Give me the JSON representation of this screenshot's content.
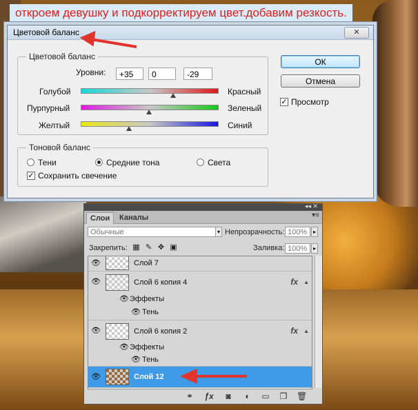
{
  "banner": {
    "text": "откроем девушку и подкорректируем цвет.добавим резкость."
  },
  "dialog": {
    "title": "Цветовой баланс",
    "close_symbol": "✕",
    "color_balance_group": {
      "legend": "Цветовой баланс",
      "levels_label": "Уровни:",
      "levels": [
        "+35",
        "0",
        "-29"
      ],
      "sliders": [
        {
          "left": "Голубой",
          "right": "Красный",
          "value": 35
        },
        {
          "left": "Пурпурный",
          "right": "Зеленый",
          "value": 0
        },
        {
          "left": "Желтый",
          "right": "Синий",
          "value": -29
        }
      ]
    },
    "tone_group": {
      "legend": "Тоновой баланс",
      "options": [
        "Тени",
        "Средние тона",
        "Света"
      ],
      "selected": "Средние тона",
      "preserve_label": "Сохранить свечение",
      "preserve_checked": true
    },
    "ok_label": "ОК",
    "cancel_label": "Отмена",
    "preview_label": "Просмотр",
    "preview_checked": true
  },
  "layers_panel": {
    "tabs": [
      "Слои",
      "Каналы"
    ],
    "active_tab": "Слои",
    "blend_mode": "Обычные",
    "opacity_label": "Непрозрачность:",
    "opacity_value": "100%",
    "lock_label": "Закрепить:",
    "fill_label": "Заливка:",
    "fill_value": "100%",
    "layers": [
      {
        "name": "Слой 7",
        "has_fx": false,
        "selected": false
      },
      {
        "name": "Слой 6 копия 4",
        "has_fx": true,
        "effects_label": "Эффекты",
        "effect": "Тень",
        "selected": false
      },
      {
        "name": "Слой 6 копия 2",
        "has_fx": true,
        "effects_label": "Эффекты",
        "effect": "Тень",
        "selected": false
      },
      {
        "name": "Слой 12",
        "has_fx": false,
        "selected": true
      }
    ],
    "fx_symbol": "fx",
    "accent_color": "#3f9be8"
  },
  "colors": {
    "annotation_red": "#e0342c",
    "banner_bg": "#d9ebf7"
  }
}
